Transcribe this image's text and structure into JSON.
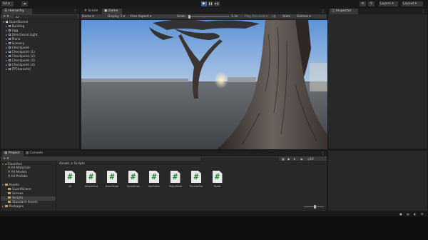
{
  "toolbar": {
    "account": "SA",
    "account_arrow": "▾",
    "cloud_icon": "cloud-icon",
    "layers_label": "Layers",
    "layout_label": "Layout",
    "play": "▶",
    "pause": "❚❚",
    "step": "▶❚"
  },
  "hierarchy": {
    "tab": "Hierarchy",
    "search_label": "All",
    "scene": "GuardScene",
    "items": [
      "Building",
      "Ugg",
      "Directional Light",
      "Plane",
      "Scenery",
      "Checkpoint",
      "Checkpoint (1)",
      "Checkpoint (2)",
      "Checkpoint (3)",
      "Checkpoint (4)",
      "FPCharacter"
    ]
  },
  "scene_tabs": {
    "scene": "Scene",
    "game": "Game"
  },
  "game_bar": {
    "mode": "Game",
    "display": "Display 1",
    "aspect": "Free Aspect",
    "scale_label": "Scale",
    "scale_value": "1.3x",
    "play_focused": "Play Focused",
    "stats": "Stats",
    "gizmos": "Gizmos"
  },
  "inspector": {
    "tab": "Inspector"
  },
  "project": {
    "tab_project": "Project",
    "tab_console": "Console",
    "breadcrumb_assets": "Assets",
    "breadcrumb_sep": ">",
    "breadcrumb_scripts": "Scripts",
    "icon_count": "10",
    "favorites": "Favorites",
    "fav_items": [
      "All Materials",
      "All Models",
      "All Prefabs"
    ],
    "assets": "Assets",
    "asset_items": [
      "GuardScene",
      "Scenes",
      "Scripts",
      "Standard Assets"
    ],
    "packages": "Packages",
    "scripts": [
      "AI",
      "AttackState",
      "BaseState",
      "GameInstall...",
      "IdleState",
      "PatrolState",
      "PursueStat...",
      "State"
    ]
  },
  "colors": {
    "accent": "#3a5f95",
    "script_icon": "#2f8a3d",
    "sky": "#7aa9de",
    "ground": "#55595e"
  }
}
